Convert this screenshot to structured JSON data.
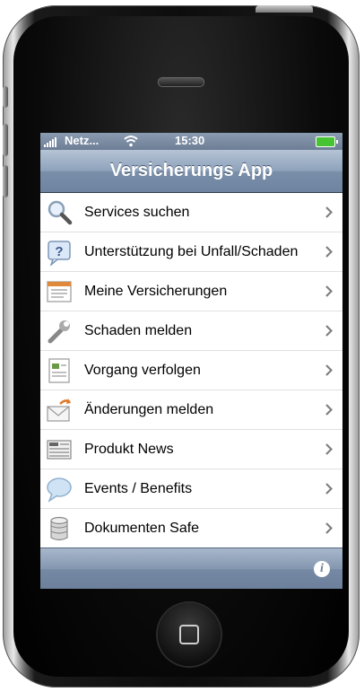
{
  "status_bar": {
    "carrier": "Netz...",
    "time": "15:30"
  },
  "nav": {
    "title": "Versicherungs App"
  },
  "menu": [
    {
      "label": "Services suchen",
      "icon": "magnifier-icon"
    },
    {
      "label": "Unterstützung bei Unfall/Schaden",
      "icon": "help-question-icon"
    },
    {
      "label": "Meine Versicherungen",
      "icon": "policy-list-icon"
    },
    {
      "label": "Schaden melden",
      "icon": "wrench-icon"
    },
    {
      "label": "Vorgang verfolgen",
      "icon": "document-track-icon"
    },
    {
      "label": "Änderungen melden",
      "icon": "mail-change-icon"
    },
    {
      "label": "Produkt News",
      "icon": "newspaper-icon"
    },
    {
      "label": "Events / Benefits",
      "icon": "speech-bubble-icon"
    },
    {
      "label": "Dokumenten Safe",
      "icon": "database-safe-icon"
    }
  ],
  "toolbar": {
    "info_icon": "info-icon",
    "info_glyph": "i"
  },
  "colors": {
    "nav_bar": "#7a8fa9",
    "toolbar": "#7589a4",
    "battery": "#46c432"
  }
}
